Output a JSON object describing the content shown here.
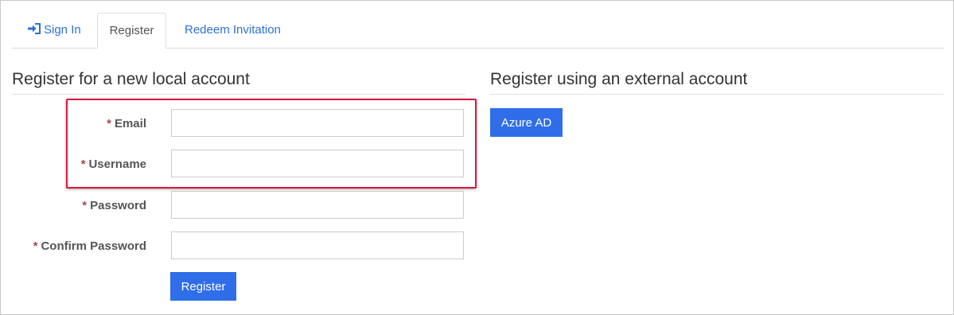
{
  "tabs": [
    {
      "label": "Sign In",
      "icon": "sign-in-icon"
    },
    {
      "label": "Register",
      "active": true
    },
    {
      "label": "Redeem Invitation"
    }
  ],
  "local": {
    "title": "Register for a new local account",
    "required_marker": "*",
    "fields": [
      {
        "label": "Email",
        "value": ""
      },
      {
        "label": "Username",
        "value": ""
      },
      {
        "label": "Password",
        "value": ""
      },
      {
        "label": "Confirm Password",
        "value": ""
      }
    ],
    "submit_label": "Register"
  },
  "external": {
    "title": "Register using an external account",
    "providers": [
      {
        "label": "Azure AD"
      }
    ]
  },
  "colors": {
    "link": "#2f6fd6",
    "button": "#2f6ee8",
    "required": "#a94442",
    "highlight": "#d61a3c"
  }
}
